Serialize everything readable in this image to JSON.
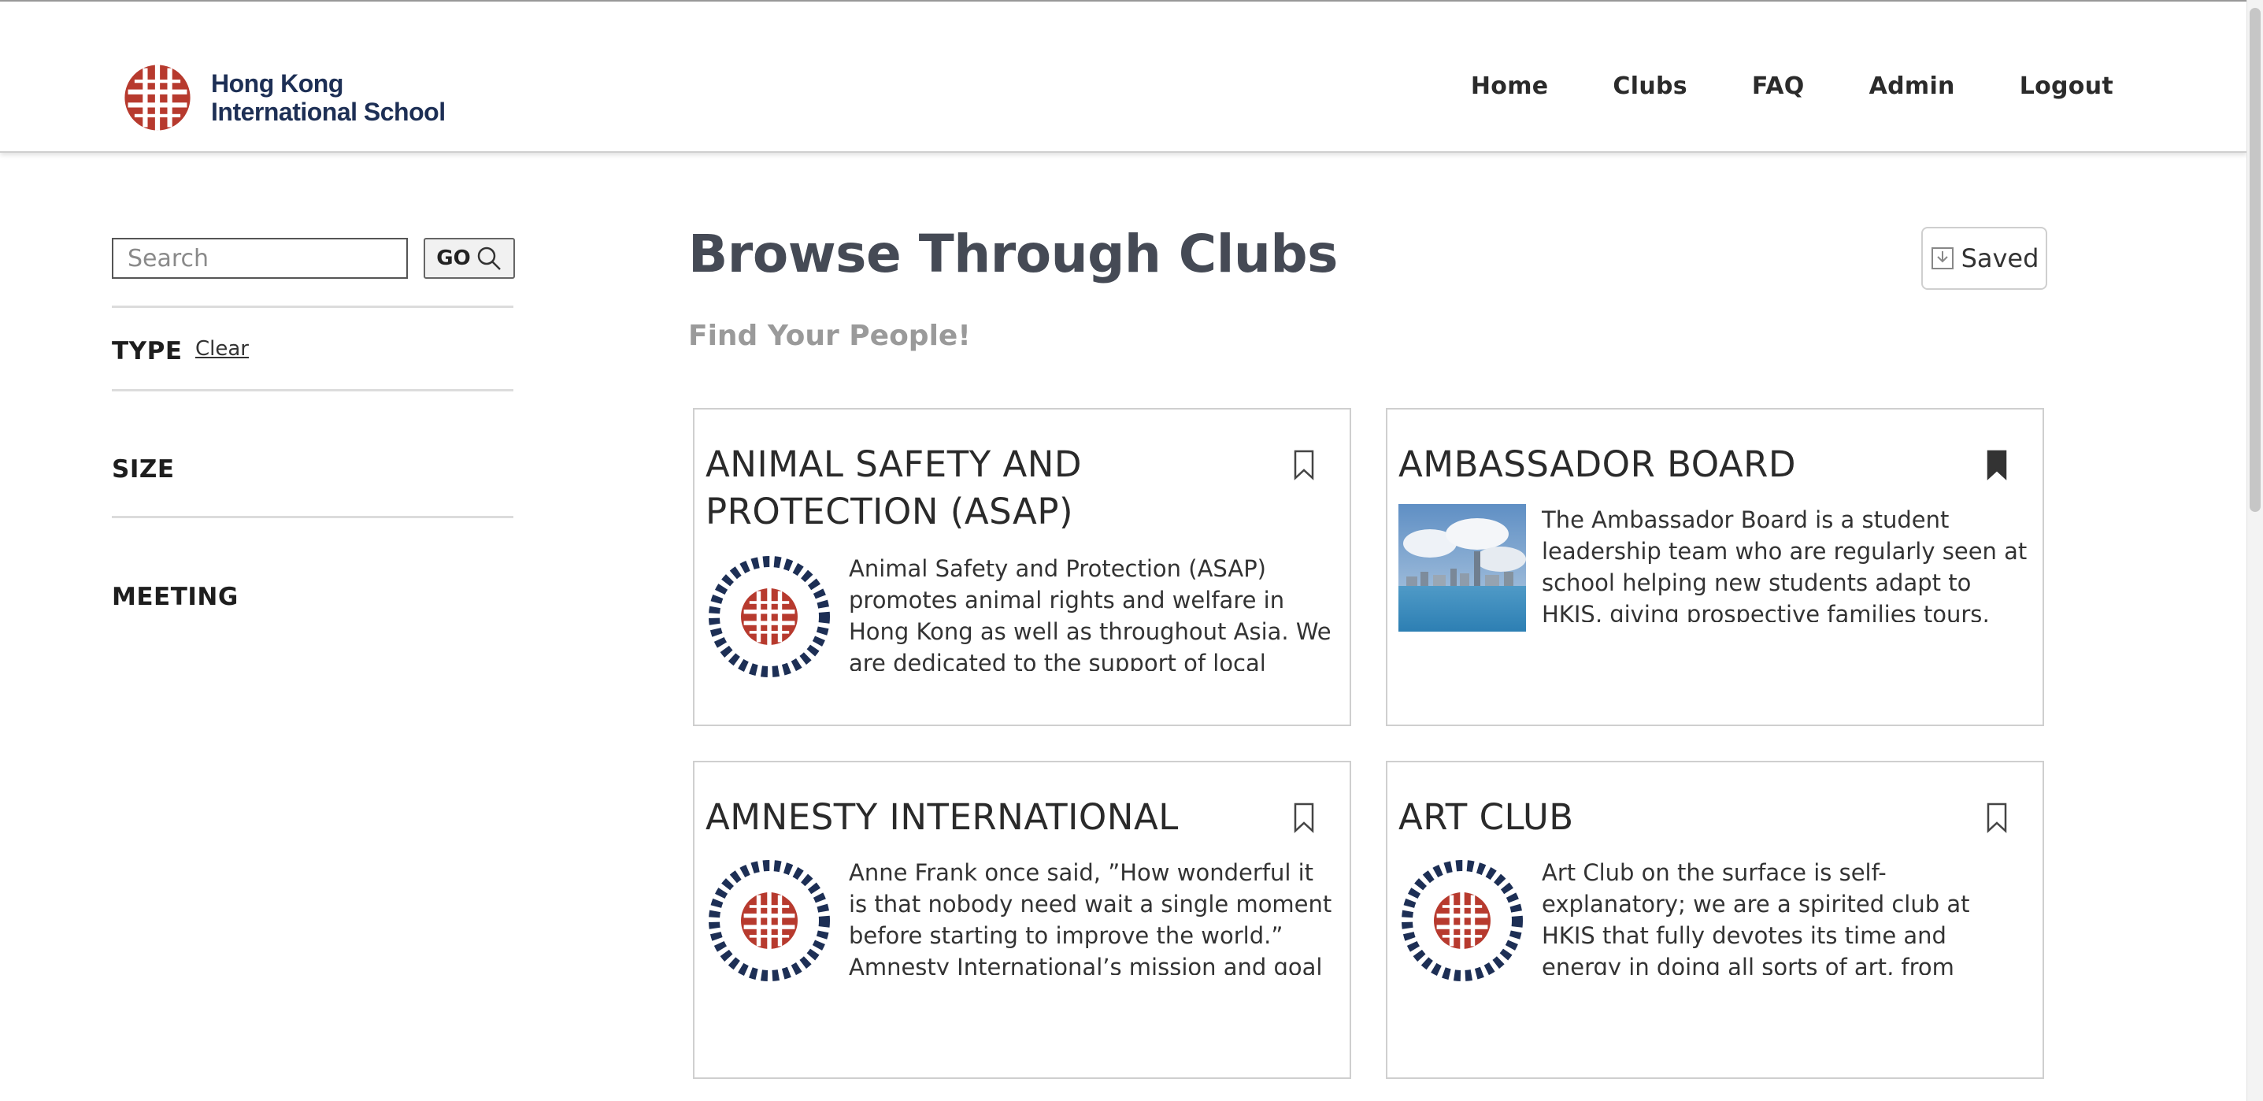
{
  "header": {
    "logo_line1": "Hong Kong",
    "logo_line2": "International School",
    "nav": [
      {
        "label": "Home"
      },
      {
        "label": "Clubs"
      },
      {
        "label": "FAQ"
      },
      {
        "label": "Admin"
      },
      {
        "label": "Logout"
      }
    ]
  },
  "sidebar": {
    "search_placeholder": "Search",
    "go_label": "GO",
    "filters": {
      "type_label": "TYPE",
      "clear_label": "Clear",
      "size_label": "SIZE",
      "meeting_label": "MEETING"
    }
  },
  "main": {
    "title": "Browse Through Clubs",
    "subtitle": "Find Your People!",
    "saved_label": "Saved",
    "clubs": [
      {
        "title": "ANIMAL SAFETY AND PROTECTION (ASAP)",
        "description": "Animal Safety and Protection (ASAP) promotes animal rights and welfare in Hong Kong as well as throughout Asia. We are dedicated to the support of local animal",
        "image": "hkis-seal-icon",
        "saved": false
      },
      {
        "title": "AMBASSADOR BOARD",
        "description": "The Ambassador Board is a student leadership team who are regularly seen at school helping new students adapt to HKIS, giving prospective families tours, offering",
        "image": "hong-kong-skyline-photo",
        "saved": true
      },
      {
        "title": "AMNESTY INTERNATIONAL",
        "description": "Anne Frank once said, ”How wonderful it is that nobody need wait a single moment before starting to improve the world.” Amnesty International’s mission and goal is to",
        "image": "hkis-seal-icon",
        "saved": false
      },
      {
        "title": "ART CLUB",
        "description": "Art Club on the surface is self-explanatory; we are a spirited club at HKIS that fully devotes its time and energy in doing all sorts of art, from sculpture to screen-printing. Beyond",
        "image": "hkis-seal-icon",
        "saved": false
      }
    ]
  },
  "colors": {
    "brand_red": "#b73a2e",
    "brand_navy": "#1d2f55",
    "title_gray": "#454a55"
  }
}
